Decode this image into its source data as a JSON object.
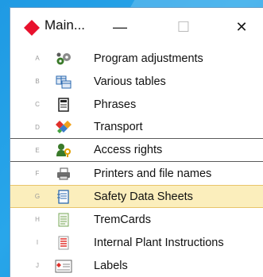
{
  "window": {
    "title": "Main...",
    "minimize_glyph": "—",
    "maximize_glyph": "☐",
    "close_glyph": "✕",
    "app_icon": "red-diamond-app-icon"
  },
  "menu": {
    "items": [
      {
        "key": "A",
        "label": "Program adjustments",
        "icon": "gears-icon"
      },
      {
        "key": "B",
        "label": "Various tables",
        "icon": "tables-icon"
      },
      {
        "key": "C",
        "label": "Phrases",
        "icon": "document-icon"
      },
      {
        "key": "D",
        "label": "Transport",
        "icon": "transport-icon"
      },
      {
        "key": "E",
        "label": "Access rights",
        "icon": "access-rights-icon"
      },
      {
        "key": "F",
        "label": "Printers and file names",
        "icon": "printer-icon"
      },
      {
        "key": "G",
        "label": "Safety Data Sheets",
        "icon": "data-sheet-icon",
        "selected": true
      },
      {
        "key": "H",
        "label": "TremCards",
        "icon": "tremcard-icon"
      },
      {
        "key": "I",
        "label": "Internal Plant Instructions",
        "icon": "instructions-icon"
      },
      {
        "key": "J",
        "label": "Labels",
        "icon": "labels-icon"
      }
    ]
  },
  "colors": {
    "accent_red": "#e8112d",
    "selection_bg": "#fbeebc",
    "selection_border": "#e8c46a",
    "backdrop_blue": "#1f9ae3"
  }
}
